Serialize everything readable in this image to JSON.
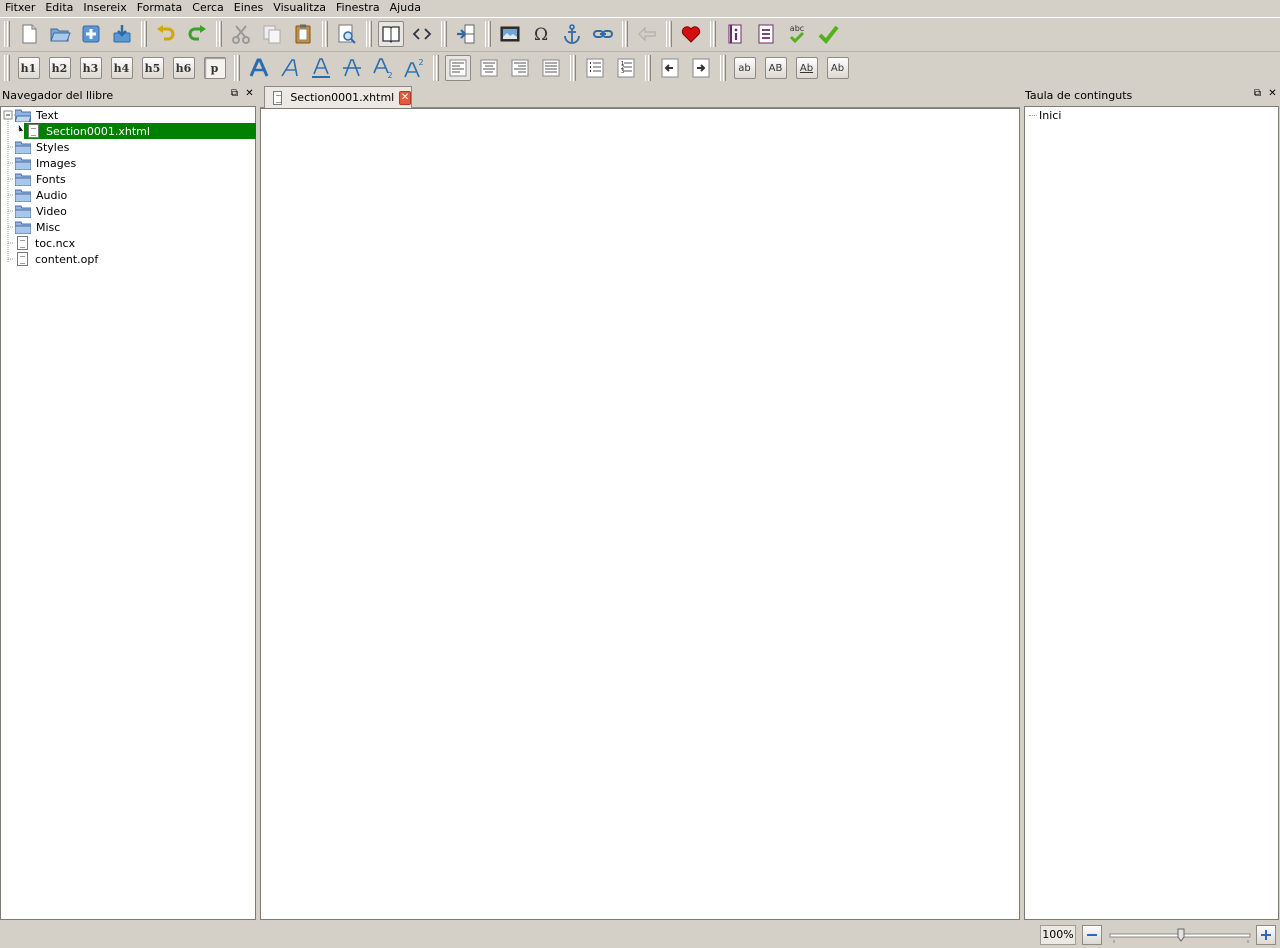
{
  "menubar": {
    "items": [
      "Fitxer",
      "Edita",
      "Insereix",
      "Formata",
      "Cerca",
      "Eines",
      "Visualitza",
      "Finestra",
      "Ajuda"
    ]
  },
  "toolbar1": {
    "icons": [
      "new-file-icon",
      "open-folder-icon",
      "add-file-icon",
      "save-icon",
      "undo-icon",
      "redo-icon",
      "cut-icon",
      "copy-icon",
      "paste-icon",
      "find-icon",
      "book-view-icon",
      "code-view-icon",
      "split-section-icon",
      "insert-image-icon",
      "special-character-icon",
      "anchor-icon",
      "link-icon",
      "go-back-icon",
      "donate-heart-icon",
      "metadata-icon",
      "table-of-contents-icon",
      "spellcheck-icon",
      "validate-check-icon"
    ]
  },
  "toolbar2": {
    "headings": [
      "h1",
      "h2",
      "h3",
      "h4",
      "h5",
      "h6",
      "p"
    ],
    "case_buttons": [
      "ab",
      "AB",
      "Ab",
      "Ab"
    ]
  },
  "book_browser": {
    "title": "Navegador del llibre",
    "items": {
      "text": "Text",
      "section": "Section0001.xhtml",
      "styles": "Styles",
      "images": "Images",
      "fonts": "Fonts",
      "audio": "Audio",
      "video": "Video",
      "misc": "Misc",
      "toc": "toc.ncx",
      "opf": "content.opf"
    }
  },
  "editor": {
    "tab_label": "Section0001.xhtml"
  },
  "toc_panel": {
    "title": "Taula de continguts",
    "entry": "Inici"
  },
  "statusbar": {
    "zoom": "100%"
  },
  "colors": {
    "selection": "#008000",
    "background": "#d4d0c8",
    "accent_blue": "#2b6cb0",
    "close_red": "#e05a3c"
  }
}
